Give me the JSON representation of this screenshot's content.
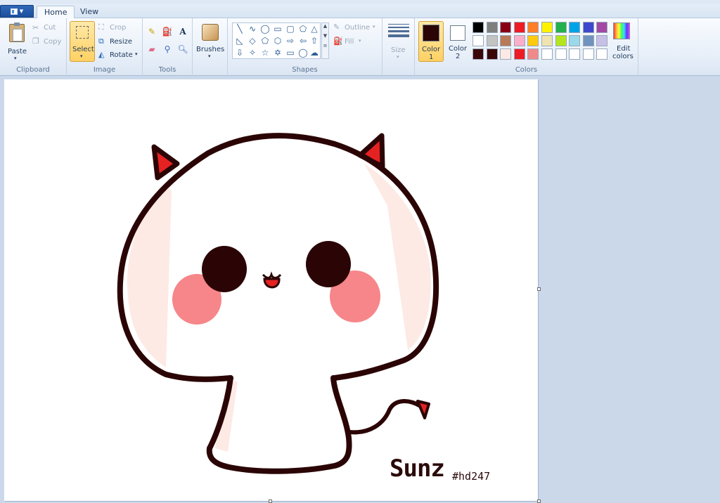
{
  "tabs": {
    "file_icon": "paint-menu-icon",
    "home": "Home",
    "view": "View"
  },
  "clipboard": {
    "paste": "Paste",
    "cut": "Cut",
    "copy": "Copy",
    "label": "Clipboard"
  },
  "image": {
    "select": "Select",
    "crop": "Crop",
    "resize": "Resize",
    "rotate": "Rotate",
    "label": "Image"
  },
  "tools": {
    "label": "Tools",
    "icons": [
      "pencil-icon",
      "fill-icon",
      "text-icon",
      "eraser-icon",
      "color-picker-icon",
      "magnifier-icon"
    ]
  },
  "brushes": {
    "label": "Brushes"
  },
  "shapes": {
    "label": "Shapes",
    "outline": "Outline",
    "fill": "Fill"
  },
  "size": {
    "label": "Size"
  },
  "colors": {
    "color1_label": "Color",
    "color1_num": "1",
    "color2_label": "Color",
    "color2_num": "2",
    "color1_value": "#2b0505",
    "color2_value": "#ffffff",
    "edit_label_1": "Edit",
    "edit_label_2": "colors",
    "label": "Colors",
    "palette_row1": [
      "#000000",
      "#7f7f7f",
      "#880015",
      "#ed1c24",
      "#ff7f27",
      "#fff200",
      "#22b14c",
      "#00a2e8",
      "#3f48cc",
      "#a349a4"
    ],
    "palette_row2": [
      "#ffffff",
      "#c3c3c3",
      "#b97a57",
      "#ffaec9",
      "#ffc90e",
      "#efe4b0",
      "#b5e61d",
      "#99d9ea",
      "#7092be",
      "#c8bfe7"
    ],
    "palette_row3": [
      "#3a0808",
      "#3a0808",
      "#fde9e4",
      "#ed1c24",
      "#f08a8a",
      "#ffffff",
      "#ffffff",
      "#ffffff",
      "#ffffff",
      "#ffffff"
    ]
  },
  "drawing": {
    "signature": "Sunz",
    "hashtag": "#hd247"
  }
}
